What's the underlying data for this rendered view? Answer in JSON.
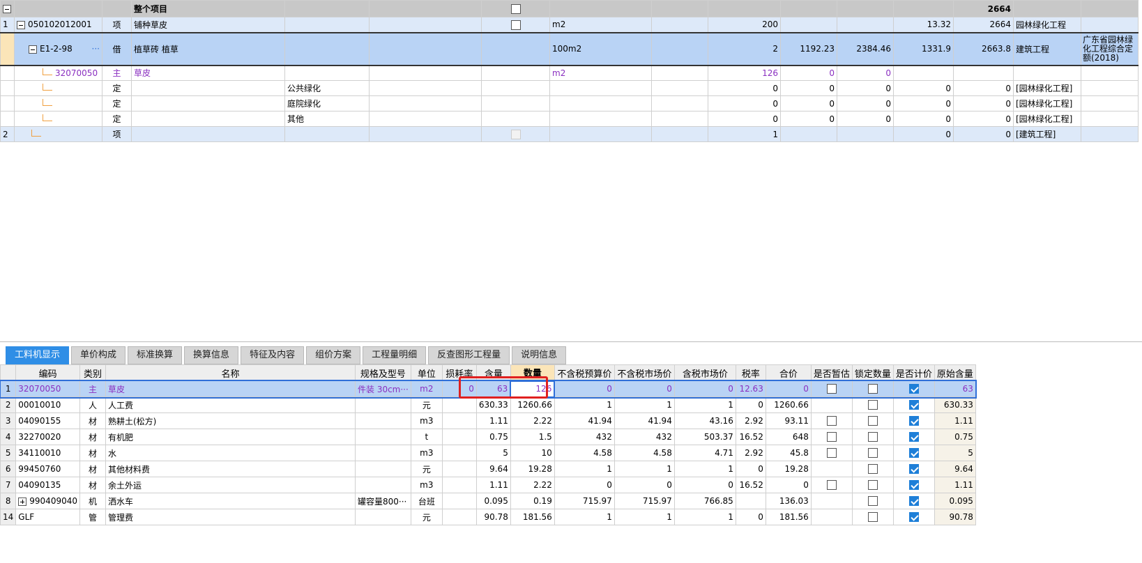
{
  "top": {
    "header": {
      "label": "整个项目",
      "total": "2664"
    },
    "rows": [
      {
        "num": "1",
        "code": "050102012001",
        "type": "项",
        "name": "铺种草皮",
        "unit": "m2",
        "qty": "200",
        "price": "13.32",
        "total": "2664",
        "category": "园林绿化工程"
      },
      {
        "code": "E1-2-98",
        "more": "···",
        "type": "借",
        "name": "植草砖 植草",
        "unit": "100m2",
        "qty": "2",
        "v1": "1192.23",
        "v2": "2384.46",
        "price": "1331.9",
        "total": "2663.8",
        "category": "建筑工程",
        "extra": "广东省园林绿化工程综合定额(2018)"
      },
      {
        "code": "32070050",
        "type": "主",
        "name": "草皮",
        "unit": "m2",
        "qty": "126",
        "v1": "0",
        "v2": "0"
      },
      {
        "type": "定",
        "sub": "公共绿化",
        "qty": "0",
        "v1": "0",
        "v2": "0",
        "price": "0",
        "total": "0",
        "category": "[园林绿化工程]"
      },
      {
        "type": "定",
        "sub": "庭院绿化",
        "qty": "0",
        "v1": "0",
        "v2": "0",
        "price": "0",
        "total": "0",
        "category": "[园林绿化工程]"
      },
      {
        "type": "定",
        "sub": "其他",
        "qty": "0",
        "v1": "0",
        "v2": "0",
        "price": "0",
        "total": "0",
        "category": "[园林绿化工程]"
      },
      {
        "num": "2",
        "type": "项",
        "qty": "1",
        "price": "0",
        "total": "0",
        "category": "[建筑工程]"
      }
    ]
  },
  "tabs": [
    "工料机显示",
    "单价构成",
    "标准换算",
    "换算信息",
    "特征及内容",
    "组价方案",
    "工程量明细",
    "反查图形工程量",
    "说明信息"
  ],
  "bottom": {
    "headers": [
      "编码",
      "类别",
      "名称",
      "规格及型号",
      "单位",
      "损耗率",
      "含量",
      "数量",
      "不含税预算价",
      "不含税市场价",
      "含税市场价",
      "税率",
      "合价",
      "是否暂估",
      "锁定数量",
      "是否计价",
      "原始含量"
    ],
    "rows": [
      {
        "n": "1",
        "code": "32070050",
        "cat": "主",
        "name": "草皮",
        "spec": "件装 30cm···",
        "unit": "m2",
        "loss": "0",
        "content": "63",
        "qty": "126",
        "p1": "0",
        "p2": "0",
        "p3": "0",
        "tax": "12.63",
        "sum": "0",
        "orig": "63"
      },
      {
        "n": "2",
        "code": "00010010",
        "cat": "人",
        "name": "人工费",
        "spec": "",
        "unit": "元",
        "loss": "",
        "content": "630.33",
        "qty": "1260.66",
        "p1": "1",
        "p2": "1",
        "p3": "1",
        "tax": "0",
        "sum": "1260.66",
        "orig": "630.33"
      },
      {
        "n": "3",
        "code": "04090155",
        "cat": "材",
        "name": "熟耕土(松方)",
        "spec": "",
        "unit": "m3",
        "loss": "",
        "content": "1.11",
        "qty": "2.22",
        "p1": "41.94",
        "p2": "41.94",
        "p3": "43.16",
        "tax": "2.92",
        "sum": "93.11",
        "orig": "1.11"
      },
      {
        "n": "4",
        "code": "32270020",
        "cat": "材",
        "name": "有机肥",
        "spec": "",
        "unit": "t",
        "loss": "",
        "content": "0.75",
        "qty": "1.5",
        "p1": "432",
        "p2": "432",
        "p3": "503.37",
        "tax": "16.52",
        "sum": "648",
        "orig": "0.75"
      },
      {
        "n": "5",
        "code": "34110010",
        "cat": "材",
        "name": "水",
        "spec": "",
        "unit": "m3",
        "loss": "",
        "content": "5",
        "qty": "10",
        "p1": "4.58",
        "p2": "4.58",
        "p3": "4.71",
        "tax": "2.92",
        "sum": "45.8",
        "orig": "5"
      },
      {
        "n": "6",
        "code": "99450760",
        "cat": "材",
        "name": "其他材料费",
        "spec": "",
        "unit": "元",
        "loss": "",
        "content": "9.64",
        "qty": "19.28",
        "p1": "1",
        "p2": "1",
        "p3": "1",
        "tax": "0",
        "sum": "19.28",
        "orig": "9.64"
      },
      {
        "n": "7",
        "code": "04090135",
        "cat": "材",
        "name": "余土外运",
        "spec": "",
        "unit": "m3",
        "loss": "",
        "content": "1.11",
        "qty": "2.22",
        "p1": "0",
        "p2": "0",
        "p3": "0",
        "tax": "16.52",
        "sum": "0",
        "orig": "1.11"
      },
      {
        "n": "8",
        "code": "990409040",
        "cat": "机",
        "name": "洒水车",
        "spec": "罐容量800···",
        "unit": "台班",
        "loss": "",
        "content": "0.095",
        "qty": "0.19",
        "p1": "715.97",
        "p2": "715.97",
        "p3": "766.85",
        "tax": "",
        "sum": "136.03",
        "orig": "0.095"
      },
      {
        "n": "14",
        "code": "GLF",
        "cat": "管",
        "name": "管理费",
        "spec": "",
        "unit": "元",
        "loss": "",
        "content": "90.78",
        "qty": "181.56",
        "p1": "1",
        "p2": "1",
        "p3": "1",
        "tax": "0",
        "sum": "181.56",
        "orig": "90.78"
      }
    ]
  }
}
